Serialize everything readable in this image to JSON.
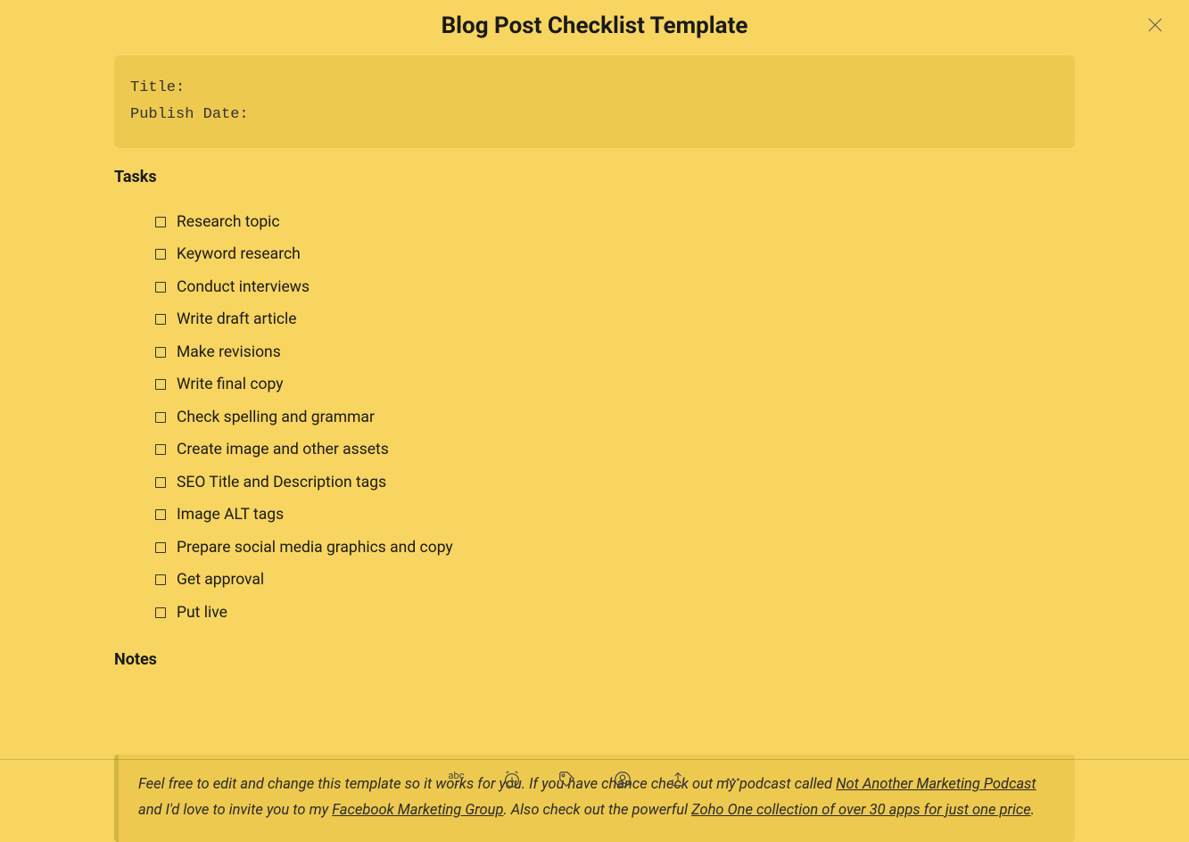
{
  "title": "Blog Post Checklist Template",
  "codeBlock": {
    "line1": "Title:",
    "line2": "Publish Date:"
  },
  "tasksHeading": "Tasks",
  "tasks": [
    "Research topic",
    "Keyword research",
    "Conduct interviews",
    "Write draft article",
    "Make revisions",
    "Write final copy",
    "Check spelling and grammar",
    "Create image and other assets",
    "SEO Title and Description tags",
    "Image ALT tags",
    "Prepare social media graphics and copy",
    "Get approval",
    "Put live"
  ],
  "notesHeading": "Notes",
  "footer": {
    "part1": "Feel free to edit and change this template so it works for you. If you have chance check out my podcast called ",
    "link1": "Not Another Marketing Podcast",
    "part2": " and I'd love to invite you to my ",
    "link2": "Facebook Marketing Group",
    "part3": ". Also check out the powerful ",
    "link3": "Zoho One collection of over 30 apps for just one price",
    "part4": "."
  },
  "toolbar": {
    "abc": "abc"
  }
}
